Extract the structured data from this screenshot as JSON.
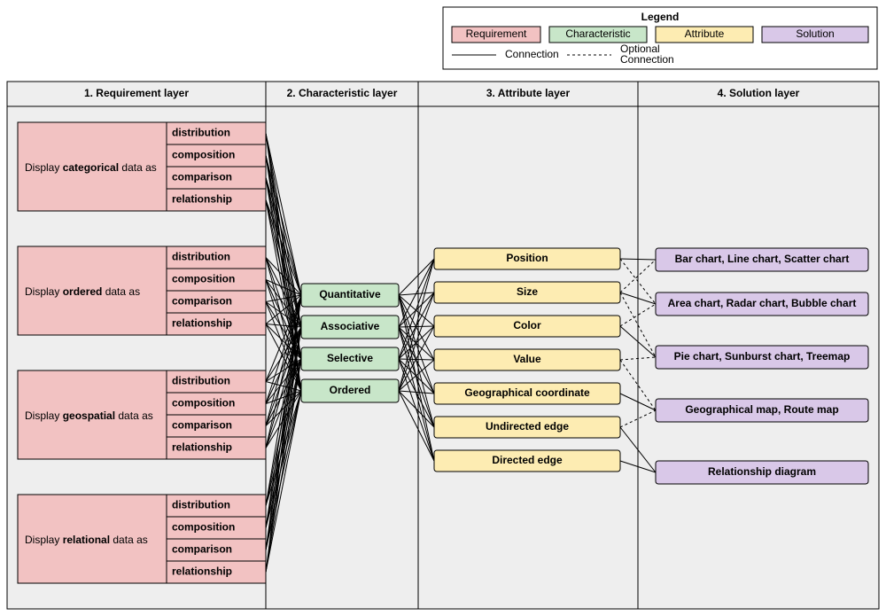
{
  "legend": {
    "title": "Legend",
    "items": [
      "Requirement",
      "Characteristic",
      "Attribute",
      "Solution"
    ],
    "conn": "Connection",
    "opt": "Optional\nConnection"
  },
  "headers": [
    "1. Requirement layer",
    "2. Characteristic layer",
    "3. Attribute layer",
    "4. Solution layer"
  ],
  "requirements": [
    {
      "prefix": "Display ",
      "bold": "categorical",
      "suffix": " data as"
    },
    {
      "prefix": "Display ",
      "bold": "ordered",
      "suffix": " data as"
    },
    {
      "prefix": "Display ",
      "bold": "geospatial",
      "suffix": " data as"
    },
    {
      "prefix": "Display ",
      "bold": "relational",
      "suffix": " data as"
    }
  ],
  "subreqs": [
    "distribution",
    "composition",
    "comparison",
    "relationship"
  ],
  "characteristics": [
    "Quantitative",
    "Associative",
    "Selective",
    "Ordered"
  ],
  "attributes": [
    "Position",
    "Size",
    "Color",
    "Value",
    "Geographical coordinate",
    "Undirected edge",
    "Directed edge"
  ],
  "solutions": [
    "Bar chart, Line chart, Scatter chart",
    "Area chart, Radar chart, Bubble chart",
    "Pie chart, Sunburst chart, Treemap",
    "Geographical map, Route map",
    "Relationship diagram"
  ]
}
